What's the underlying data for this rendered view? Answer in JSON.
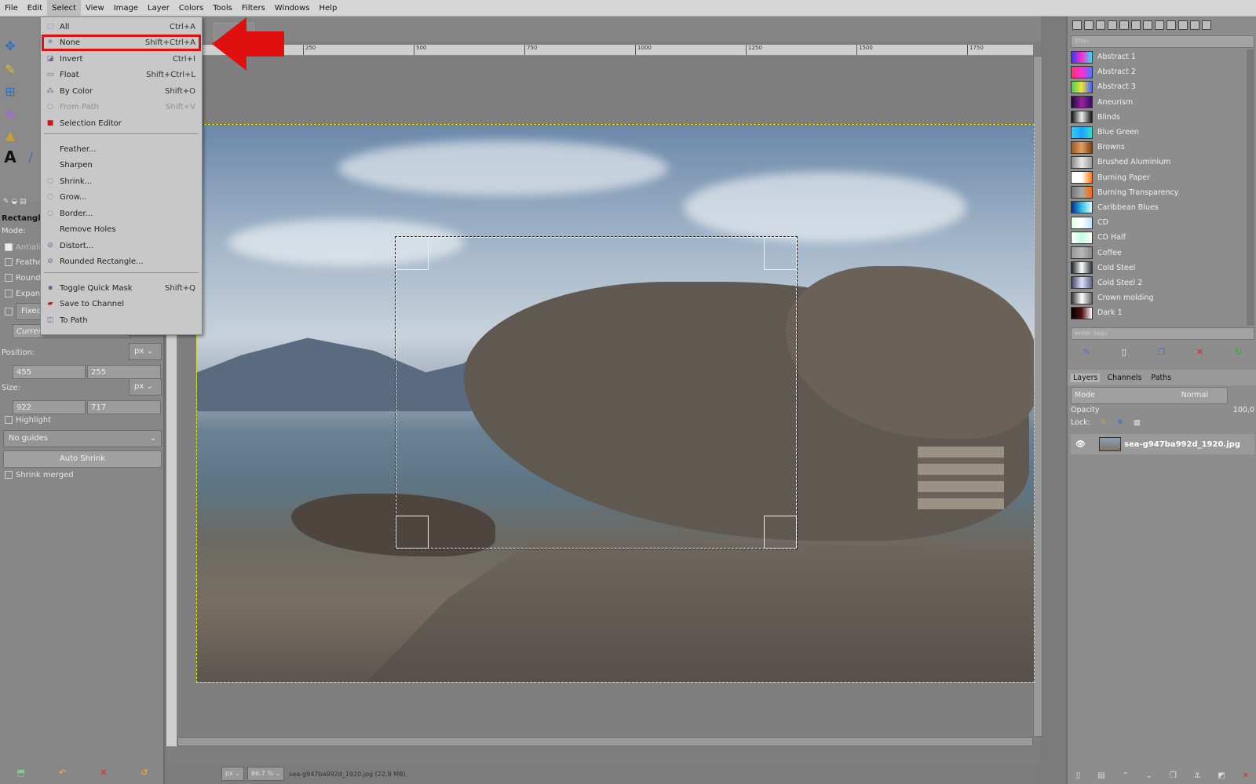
{
  "menubar": {
    "items": [
      "File",
      "Edit",
      "Select",
      "View",
      "Image",
      "Layer",
      "Colors",
      "Tools",
      "Filters",
      "Windows",
      "Help"
    ],
    "active": "Select"
  },
  "select_menu": {
    "items": [
      {
        "label": "All",
        "shortcut": "Ctrl+A",
        "icon": "select-all-icon",
        "enabled": true
      },
      {
        "label": "None",
        "shortcut": "Shift+Ctrl+A",
        "icon": "select-none-icon",
        "enabled": true,
        "highlighted": true
      },
      {
        "label": "Invert",
        "shortcut": "Ctrl+I",
        "icon": "invert-icon",
        "enabled": true
      },
      {
        "label": "Float",
        "shortcut": "Shift+Ctrl+L",
        "icon": "float-icon",
        "enabled": true
      },
      {
        "label": "By Color",
        "shortcut": "Shift+O",
        "icon": "by-color-icon",
        "enabled": true
      },
      {
        "label": "From Path",
        "shortcut": "Shift+V",
        "icon": "from-path-icon",
        "enabled": false
      },
      {
        "label": "Selection Editor",
        "shortcut": "",
        "icon": "selection-editor-icon",
        "enabled": true
      },
      {
        "label": "Feather...",
        "shortcut": "",
        "icon": "",
        "enabled": true
      },
      {
        "label": "Sharpen",
        "shortcut": "",
        "icon": "",
        "enabled": true
      },
      {
        "label": "Shrink...",
        "shortcut": "",
        "icon": "shrink-icon",
        "enabled": true
      },
      {
        "label": "Grow...",
        "shortcut": "",
        "icon": "grow-icon",
        "enabled": true
      },
      {
        "label": "Border...",
        "shortcut": "",
        "icon": "border-icon",
        "enabled": true
      },
      {
        "label": "Remove Holes",
        "shortcut": "",
        "icon": "",
        "enabled": true
      },
      {
        "label": "Distort...",
        "shortcut": "",
        "icon": "distort-icon",
        "enabled": true
      },
      {
        "label": "Rounded Rectangle...",
        "shortcut": "",
        "icon": "rounded-rect-icon",
        "enabled": true
      },
      {
        "label": "Toggle Quick Mask",
        "shortcut": "Shift+Q",
        "icon": "quick-mask-icon",
        "enabled": true
      },
      {
        "label": "Save to Channel",
        "shortcut": "",
        "icon": "save-channel-icon",
        "enabled": true
      },
      {
        "label": "To Path",
        "shortcut": "",
        "icon": "to-path-icon",
        "enabled": true
      }
    ]
  },
  "tool_options": {
    "title": "Rectangle",
    "mode_label": "Mode:",
    "antialiasing": "Antialiasing",
    "feather": "Feather",
    "rounded": "Rounde",
    "expand": "Expand",
    "fixed": "Fixed",
    "current": "Current",
    "position_label": "Position:",
    "position_unit": "px",
    "pos_x": "455",
    "pos_y": "255",
    "size_label": "Size:",
    "size_unit": "px",
    "size_w": "922",
    "size_h": "717",
    "highlight": "Highlight",
    "guides": "No guides",
    "auto_shrink": "Auto Shrink",
    "shrink_merged": "Shrink merged"
  },
  "ruler": {
    "ticks": [
      "250",
      "500",
      "750",
      "1000",
      "1250",
      "1500",
      "1750"
    ]
  },
  "status": {
    "unit": "px",
    "zoom": "66.7 %",
    "text": "sea-g947ba992d_1920.jpg (22,9 MB)"
  },
  "gradients": {
    "filter_placeholder": "filter",
    "tags_placeholder": "enter tags",
    "items": [
      {
        "name": "Abstract 1",
        "colors": [
          "#2c3cff",
          "#ff2cc8",
          "#2ce0ff"
        ]
      },
      {
        "name": "Abstract 2",
        "colors": [
          "#ff2f6e",
          "#ff2fd8",
          "#3f7bff"
        ]
      },
      {
        "name": "Abstract 3",
        "colors": [
          "#44d44a",
          "#f0e040",
          "#4060ff"
        ]
      },
      {
        "name": "Aneurism",
        "colors": [
          "#1a0a3a",
          "#a020a0",
          "#2a1060"
        ]
      },
      {
        "name": "Blinds",
        "colors": [
          "#111111",
          "#eeeeee",
          "#111111"
        ]
      },
      {
        "name": "Blue Green",
        "colors": [
          "#2ad0ff",
          "#20a0ff",
          "#30e0d0"
        ]
      },
      {
        "name": "Browns",
        "colors": [
          "#a05a20",
          "#e0a060",
          "#7a4010"
        ]
      },
      {
        "name": "Brushed Aluminium",
        "colors": [
          "#888888",
          "#e8e8e8",
          "#999999"
        ]
      },
      {
        "name": "Burning Paper",
        "colors": [
          "#ffffff",
          "#ffffff",
          "#ff7a00"
        ]
      },
      {
        "name": "Burning Transparency",
        "colors": [
          "#777777",
          "#aaaaaa",
          "#ff6a00"
        ]
      },
      {
        "name": "Caribbean Blues",
        "colors": [
          "#0030a0",
          "#30c0e0",
          "#e0ffff"
        ]
      },
      {
        "name": "CD",
        "colors": [
          "#e0ffe0",
          "#ffffff",
          "#c0e0ff"
        ]
      },
      {
        "name": "CD Half",
        "colors": [
          "#ffffff",
          "#c0ffe0",
          "#ffffff"
        ]
      },
      {
        "name": "Coffee",
        "colors": [
          "#999999",
          "#b8b8b8",
          "#888888"
        ]
      },
      {
        "name": "Cold Steel",
        "colors": [
          "#202030",
          "#ffffff",
          "#303040"
        ]
      },
      {
        "name": "Cold Steel 2",
        "colors": [
          "#404060",
          "#e0e0ff",
          "#606080"
        ]
      },
      {
        "name": "Crown molding",
        "colors": [
          "#333333",
          "#ffffff",
          "#666666"
        ]
      },
      {
        "name": "Dark 1",
        "colors": [
          "#000000",
          "#501010",
          "#ffffff"
        ]
      }
    ]
  },
  "layers": {
    "tabs": [
      "Layers",
      "Channels",
      "Paths"
    ],
    "mode_label": "Mode",
    "mode_value": "Normal",
    "opacity_label": "Opacity",
    "opacity_value": "100,0",
    "lock_label": "Lock:",
    "layer_name": "sea-g947ba992d_1920.jpg"
  },
  "colors": {
    "highlight_red": "#e01010",
    "menu_bg": "#c8c8c8",
    "selection_border": "#e6e600"
  }
}
